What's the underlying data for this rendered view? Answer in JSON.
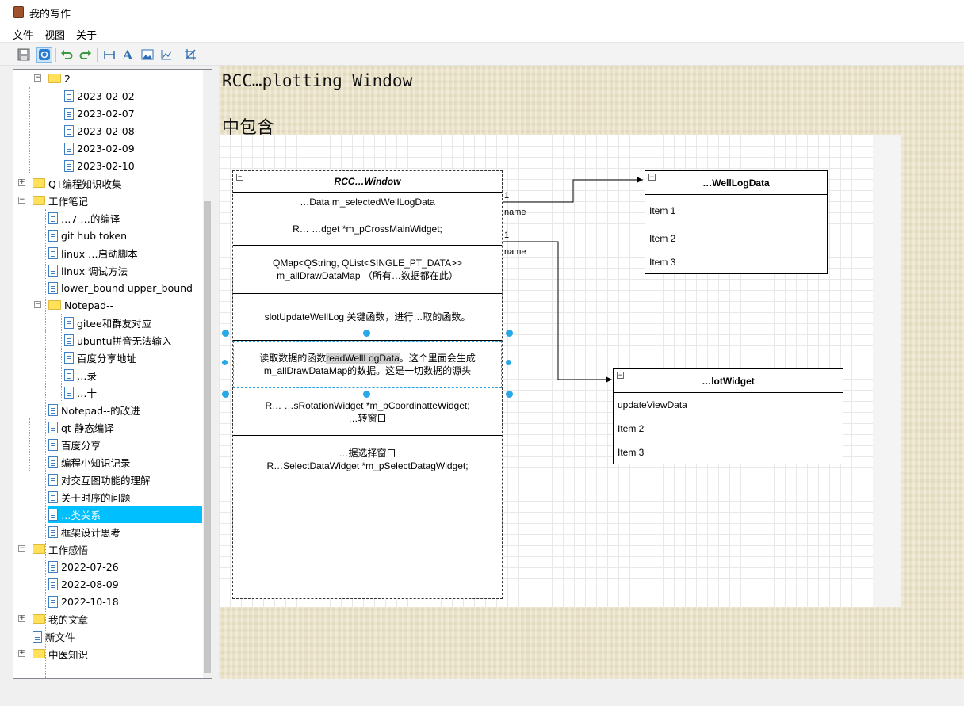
{
  "window": {
    "title": "我的写作"
  },
  "menu": [
    "文件",
    "视图",
    "关于"
  ],
  "toolbar": {
    "buttons": [
      "save-icon",
      "settings-icon",
      "undo-icon",
      "redo-icon",
      "width-icon",
      "font-icon",
      "image-icon",
      "chart-icon",
      "crop-icon"
    ]
  },
  "tree": [
    {
      "label": "2",
      "type": "folder",
      "level": 1,
      "expanded": true
    },
    {
      "label": "2023-02-02",
      "type": "file",
      "level": 2
    },
    {
      "label": "2023-02-07",
      "type": "file",
      "level": 2
    },
    {
      "label": "2023-02-08",
      "type": "file",
      "level": 2
    },
    {
      "label": "2023-02-09",
      "type": "file",
      "level": 2
    },
    {
      "label": "2023-02-10",
      "type": "file",
      "level": 2
    },
    {
      "label": "QT编程知识收集",
      "type": "folder",
      "level": 0,
      "expanded": false
    },
    {
      "label": "工作笔记",
      "type": "folder",
      "level": 0,
      "expanded": true
    },
    {
      "label": "…7 …的编译",
      "type": "file",
      "level": 1
    },
    {
      "label": "git hub token",
      "type": "file",
      "level": 1
    },
    {
      "label": "linux …启动脚本",
      "type": "file",
      "level": 1
    },
    {
      "label": "linux 调试方法",
      "type": "file",
      "level": 1
    },
    {
      "label": "lower_bound upper_bound",
      "type": "file",
      "level": 1
    },
    {
      "label": "Notepad--",
      "type": "folder",
      "level": 1,
      "expanded": true
    },
    {
      "label": "gitee和群友对应",
      "type": "file",
      "level": 2
    },
    {
      "label": "ubuntu拼音无法输入",
      "type": "file",
      "level": 2
    },
    {
      "label": "百度分享地址",
      "type": "file",
      "level": 2
    },
    {
      "label": "…录",
      "type": "file",
      "level": 2
    },
    {
      "label": "…十",
      "type": "file",
      "level": 2
    },
    {
      "label": "Notepad--的改进",
      "type": "file",
      "level": 1
    },
    {
      "label": "qt 静态编译",
      "type": "file",
      "level": 1
    },
    {
      "label": "百度分享",
      "type": "file",
      "level": 1
    },
    {
      "label": "编程小知识记录",
      "type": "file",
      "level": 1
    },
    {
      "label": "对交互图功能的理解",
      "type": "file",
      "level": 1
    },
    {
      "label": "关于时序的问题",
      "type": "file",
      "level": 1
    },
    {
      "label": "…类关系",
      "type": "file",
      "level": 1,
      "selected": true
    },
    {
      "label": "框架设计思考",
      "type": "file",
      "level": 1
    },
    {
      "label": "工作感悟",
      "type": "folder",
      "level": 0,
      "expanded": true
    },
    {
      "label": "2022-07-26",
      "type": "file",
      "level": 1
    },
    {
      "label": "2022-08-09",
      "type": "file",
      "level": 1
    },
    {
      "label": "2022-10-18",
      "type": "file",
      "level": 1
    },
    {
      "label": "我的文章",
      "type": "folder",
      "level": 0,
      "expanded": false
    },
    {
      "label": "新文件",
      "type": "file",
      "level": 0
    },
    {
      "label": "中医知识",
      "type": "folder",
      "level": 0,
      "expanded": false
    }
  ],
  "doc": {
    "heading1": "RCC…plotting Window",
    "heading2": "中包含"
  },
  "diagram": {
    "main_class": {
      "title": "RCC…Window",
      "fields": [
        "…Data m_selectedWellLogData",
        "R… …dget *m_pCrossMainWidget;",
        "QMap<QString, QList<SINGLE_PT_DATA>>",
        "m_allDrawDataMap （所有…数据都在此）",
        "slotUpdateWellLog 关键函数，进行…取的函数。",
        "读取数据的函数",
        "readWellLogData",
        "。这个里面会生成",
        "m_allDrawDataMap的数据。这是一切数据的源头",
        "R… …sRotationWidget *m_pCoordinatteWidget;",
        "…转窗口",
        "…据选择窗口",
        "R…SelectDataWidget *m_pSelectDatagWidget;"
      ]
    },
    "class_a": {
      "title": "…WellLogData",
      "items": [
        "Item 1",
        "Item 2",
        "Item 3"
      ]
    },
    "class_b": {
      "title": "…lotWidget",
      "items": [
        "updateViewData",
        "Item 2",
        "Item 3"
      ]
    },
    "edges": [
      {
        "mult": "1",
        "label": "name"
      },
      {
        "mult": "1",
        "label": "name"
      }
    ]
  }
}
